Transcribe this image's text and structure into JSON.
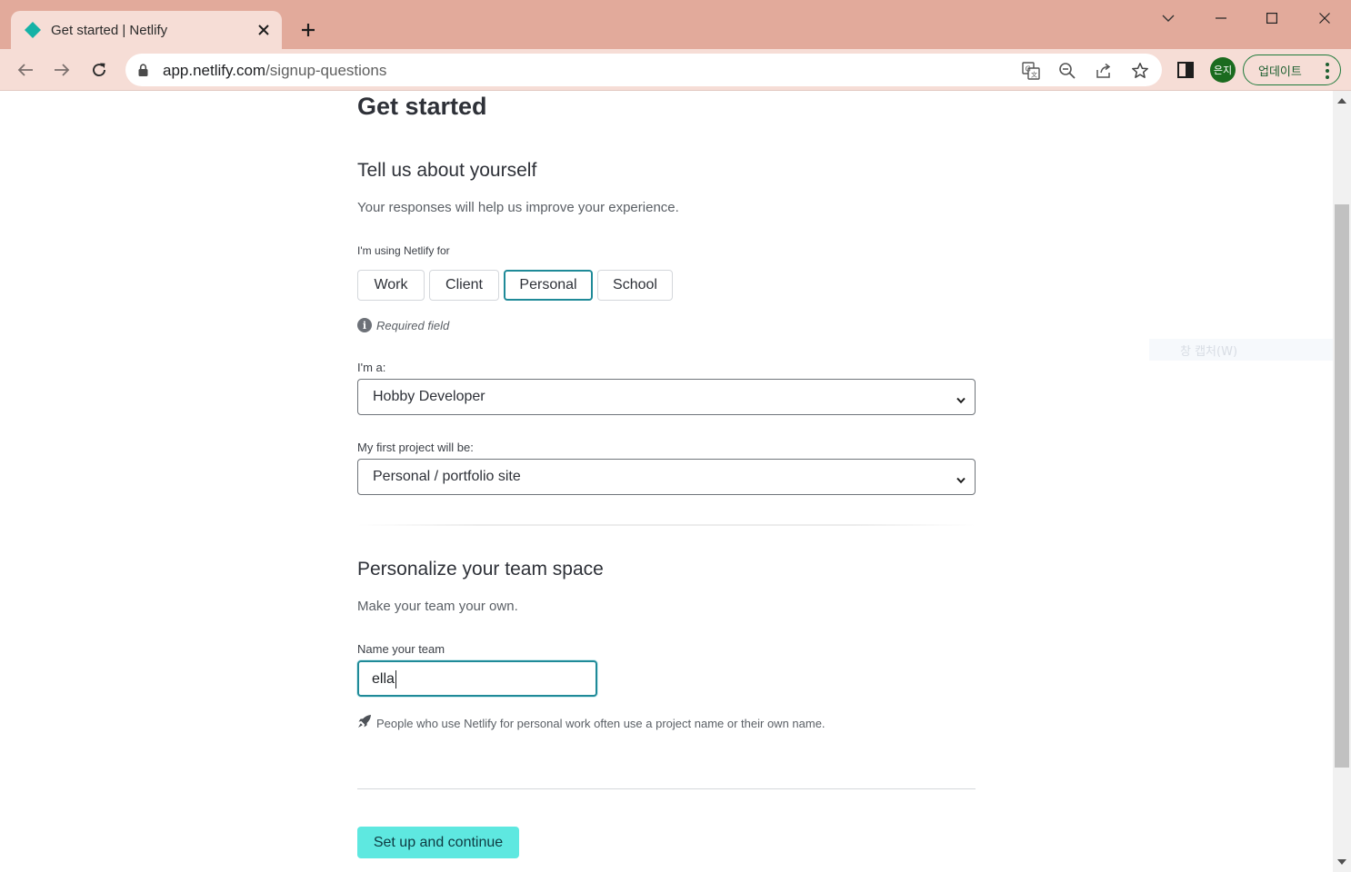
{
  "browser": {
    "tab": {
      "title": "Get started | Netlify",
      "favicon": "netlify-diamond-icon"
    },
    "new_tab_icon": "plus-icon",
    "window_controls": [
      "chevron-down-icon",
      "minimize-icon",
      "maximize-icon",
      "close-icon"
    ],
    "address": {
      "host": "app.netlify.com",
      "path": "/signup-questions"
    },
    "nav_icons": [
      "back-arrow-icon",
      "forward-arrow-icon",
      "reload-icon"
    ],
    "omnibox_icons": [
      "translate-icon",
      "zoom-out-icon",
      "share-icon",
      "star-icon"
    ],
    "profile": {
      "initials": "은지",
      "color": "#1b6b1f"
    },
    "update_button": "업데이트"
  },
  "page": {
    "title": "Get started",
    "about": {
      "heading": "Tell us about yourself",
      "subtitle": "Your responses will help us improve your experience.",
      "using_label": "I'm using Netlify for",
      "options": [
        "Work",
        "Client",
        "Personal",
        "School"
      ],
      "selected_option": "Personal",
      "required_note": "Required field",
      "role_label": "I'm a:",
      "role_value": "Hobby Developer",
      "project_label": "My first project will be:",
      "project_value": "Personal / portfolio site"
    },
    "team": {
      "heading": "Personalize your team space",
      "subtitle": "Make your team your own.",
      "name_label": "Name your team",
      "name_value": "ella",
      "hint": "People who use Netlify for personal work often use a project name or their own name."
    },
    "submit_label": "Set up and continue",
    "overlay_text": "창 캡처(W)"
  },
  "colors": {
    "accent_teal": "#1f8a98",
    "cta_background": "#5ee8e0",
    "titlebar": "#e2aa9b",
    "toolbar": "#f6ddd6"
  }
}
